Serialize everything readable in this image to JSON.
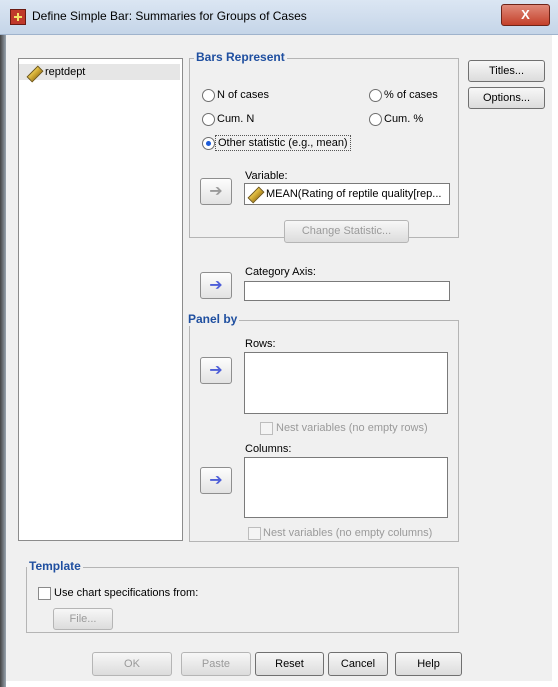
{
  "window": {
    "title": "Define Simple Bar: Summaries for Groups of Cases",
    "close_label": "X"
  },
  "variables": [
    {
      "label": "reptdept",
      "icon": "ruler-pencil-icon"
    }
  ],
  "bars_represent": {
    "legend": "Bars Represent",
    "options": {
      "n_cases": "N of cases",
      "pct_cases": "% of cases",
      "cum_n": "Cum. N",
      "cum_pct": "Cum. %",
      "other": "Other statistic (e.g., mean)"
    },
    "selected": "other",
    "variable_label": "Variable:",
    "variable_value": "MEAN(Rating of reptile quality[rep...",
    "change_statistic": "Change Statistic..."
  },
  "category_axis": {
    "label": "Category Axis:",
    "value": ""
  },
  "panel_by": {
    "legend": "Panel by",
    "rows_label": "Rows:",
    "nest_rows": "Nest variables (no empty rows)",
    "columns_label": "Columns:",
    "nest_columns": "Nest variables (no empty columns)"
  },
  "template": {
    "legend": "Template",
    "use_chart_spec": "Use chart specifications from:",
    "file_button": "File..."
  },
  "side_buttons": {
    "titles": "Titles...",
    "options": "Options..."
  },
  "footer_buttons": {
    "ok": "OK",
    "paste": "Paste",
    "reset": "Reset",
    "cancel": "Cancel",
    "help": "Help"
  },
  "colors": {
    "accent_legend": "#1f4fa0",
    "arrow_active": "#4d5ed8",
    "selected_radio": "#1c5bd9"
  }
}
